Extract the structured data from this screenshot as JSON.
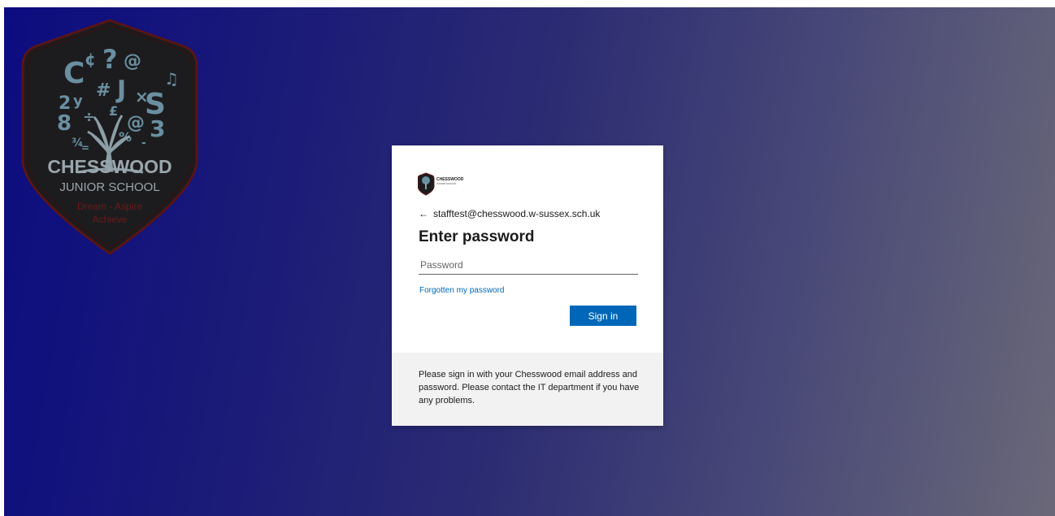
{
  "crest": {
    "name_line1": "CHESSWOOD",
    "name_line2": "JUNIOR SCHOOL",
    "motto_line1": "Dream - Aspire",
    "motto_line2": "Achieve",
    "colors": {
      "shield": "#1c1c1e",
      "border": "#5a1414",
      "motto": "#6b1a1a",
      "tree": "#6a8fa0"
    }
  },
  "login": {
    "logo_text": "CHESSWOOD",
    "logo_subtext": "JUNIOR SCHOOL",
    "email": "stafftest@chesswood.w-sussex.sch.uk",
    "back_icon": "arrow-left-icon",
    "title": "Enter password",
    "password_placeholder": "Password",
    "forgot_link": "Forgotten my password",
    "signin_label": "Sign in",
    "footer_text": "Please sign in with your Chesswood email address and password. Please contact the IT department if you have any problems."
  },
  "colors": {
    "accent": "#0067b8",
    "bg_start": "#0c0c80",
    "bg_end": "#6a6878"
  }
}
